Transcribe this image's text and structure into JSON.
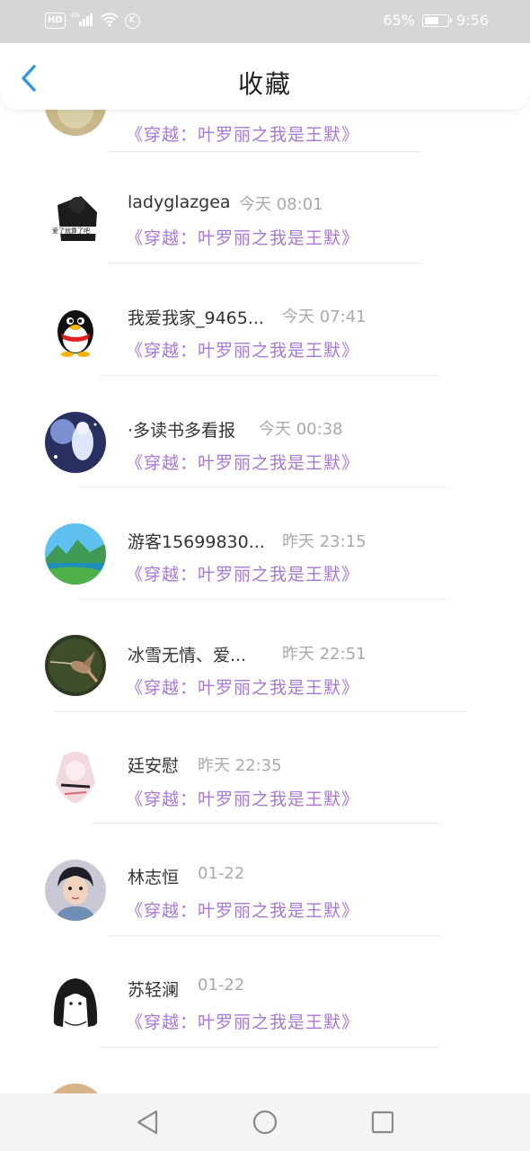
{
  "status_bar": {
    "left_icons": [
      "hd-icon",
      "signal-4g-icon",
      "wifi-icon",
      "k-icon"
    ],
    "hd": "HD",
    "net": "4G",
    "k": "K",
    "battery_percent": "65%",
    "battery_level": 0.65,
    "time": "9:56"
  },
  "header": {
    "title": "收藏",
    "back_icon": "chevron-left-icon",
    "accent_color": "#2f9ae0"
  },
  "colors": {
    "book_title": "#a877d6",
    "timestamp": "#a9a9a9",
    "name": "#333333"
  },
  "list": {
    "items": [
      {
        "name": "",
        "time": "",
        "book": "《穿越：叶罗丽之我是王默》",
        "avatar": "avatar-partial-top"
      },
      {
        "name": "ladyglazgea",
        "time": "今天 08:01",
        "book": "《穿越：叶罗丽之我是王默》",
        "avatar": "avatar-dark-figure"
      },
      {
        "name": "我爱我家_9465...",
        "time": "今天 07:41",
        "book": "《穿越：叶罗丽之我是王默》",
        "avatar": "qq-penguin-avatar"
      },
      {
        "name": "·多读书多看报",
        "time": "今天 00:38",
        "book": "《穿越：叶罗丽之我是王默》",
        "avatar": "avatar-moonlight-girl"
      },
      {
        "name": "游客15699830...",
        "time": "昨天 23:15",
        "book": "《穿越：叶罗丽之我是王默》",
        "avatar": "avatar-landscape"
      },
      {
        "name": "冰雪无情、爱...",
        "time": "昨天 22:51",
        "book": "《穿越：叶罗丽之我是王默》",
        "avatar": "avatar-hummingbird"
      },
      {
        "name": "廷安慰",
        "time": "昨天 22:35",
        "book": "《穿越：叶罗丽之我是王默》",
        "avatar": "avatar-anime-pink"
      },
      {
        "name": "林志恒",
        "time": "01-22",
        "book": "《穿越：叶罗丽之我是王默》",
        "avatar": "avatar-cartoon-boy"
      },
      {
        "name": "苏轻澜",
        "time": "01-22",
        "book": "《穿越：叶罗丽之我是王默》",
        "avatar": "avatar-anime-bw"
      },
      {
        "name": "",
        "time": "",
        "book": "",
        "avatar": "avatar-partial-bottom"
      }
    ]
  },
  "nav_bar": {
    "back": "triangle-back-icon",
    "home": "circle-home-icon",
    "recents": "square-recents-icon"
  }
}
